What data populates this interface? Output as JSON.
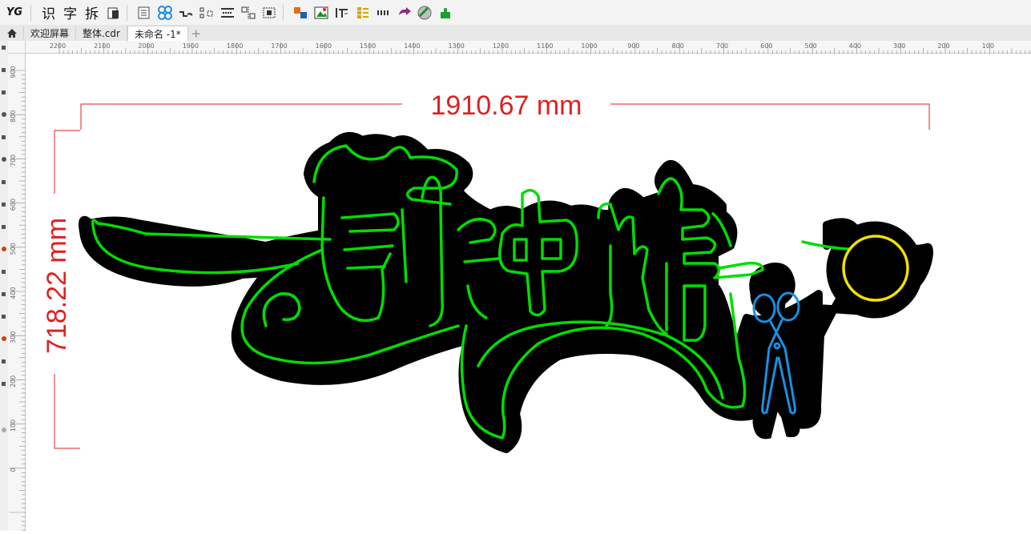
{
  "toolbar": {
    "logo": "YG",
    "btn_shi": "识",
    "btn_zi": "字",
    "btn_chai": "拆",
    "icons": [
      "clipboard-icon",
      "doc-list-icon",
      "pattern-icon",
      "curve-icon",
      "node-icon",
      "align-icon",
      "distribute-icon",
      "select-frame-icon",
      "color-fill-icon",
      "image-frame-icon",
      "text-align-icon",
      "bullet-list-icon",
      "dots-grid-icon",
      "undo-arrow-icon",
      "globe-pen-icon",
      "puzzle-icon"
    ]
  },
  "tabs": {
    "welcome": "欢迎屏幕",
    "file1": "整体.cdr",
    "file2": "未命名 -1*",
    "add": "+"
  },
  "ruler": {
    "h_labels": [
      "2200",
      "2100",
      "2000",
      "1900",
      "1800",
      "1700",
      "1600",
      "1500",
      "1400",
      "1300",
      "1200",
      "1100",
      "1000",
      "900",
      "800",
      "700",
      "600",
      "500",
      "400",
      "300",
      "200",
      "100"
    ],
    "v_labels": [
      "900",
      "800",
      "700",
      "600",
      "500",
      "400",
      "300",
      "200",
      "100",
      "0"
    ]
  },
  "canvas": {
    "width_dimension": "1910.67 mm",
    "height_dimension": "718.22 mm",
    "colors": {
      "dimension": "#e02020",
      "outline": "#00dd00",
      "fill": "#000000",
      "circle_ring": "#f5e000",
      "scissors": "#1a8fe0"
    }
  }
}
